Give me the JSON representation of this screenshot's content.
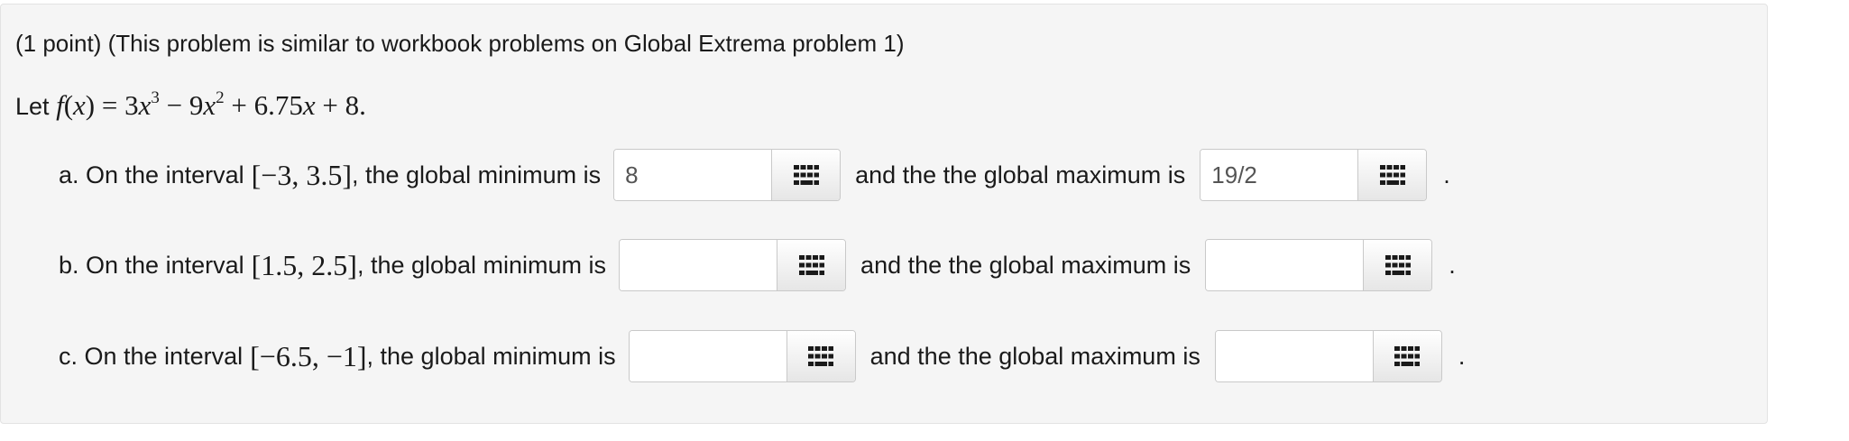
{
  "problem": {
    "header": "(1 point) (This problem is similar to workbook problems on Global Extrema problem 1)",
    "let_label": "Let",
    "function": {
      "name": "f",
      "var": "x",
      "term1_coef": "3",
      "term1_exp": "3",
      "op1": "−",
      "term2_coef": "9",
      "term2_exp": "2",
      "op2": "+",
      "term3": "6.75",
      "op3": "+",
      "constant": "8"
    }
  },
  "parts": [
    {
      "prefix": "a. On the interval",
      "interval": "[−3, 3.5]",
      "min_text": ", the global minimum is",
      "min_value": "8",
      "max_text": "and the the global maximum is",
      "max_value": "19/2",
      "end": "."
    },
    {
      "prefix": "b. On the interval",
      "interval": "[1.5, 2.5]",
      "min_text": ", the global minimum is",
      "min_value": "",
      "max_text": "and the the global maximum is",
      "max_value": "",
      "end": "."
    },
    {
      "prefix": "c. On the interval",
      "interval": "[−6.5, −1]",
      "min_text": ", the global minimum is",
      "min_value": "",
      "max_text": "and the the global maximum is",
      "max_value": "",
      "end": "."
    }
  ],
  "icons": {
    "equation_editor": "keypad-grid-icon"
  },
  "colors": {
    "panel_bg": "#f5f5f5",
    "border": "#c9c9c9",
    "text": "#1a1a1a"
  }
}
